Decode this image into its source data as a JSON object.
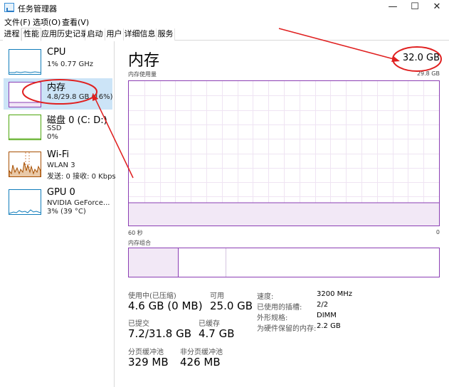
{
  "window": {
    "title": "任务管理器",
    "controls": {
      "minimize": "—",
      "maximize": "☐",
      "close": "✕"
    }
  },
  "menu": [
    "文件(F)",
    "选项(O)",
    "查看(V)"
  ],
  "tabs": [
    "进程",
    "性能",
    "应用历史记录",
    "启动",
    "用户",
    "详细信息",
    "服务"
  ],
  "active_tab": 1,
  "sidebar": {
    "items": [
      {
        "name": "CPU",
        "sub1": "1% 0.77 GHz",
        "sub2": ""
      },
      {
        "name": "内存",
        "sub1": "4.8/29.8 GB (16%)",
        "sub2": ""
      },
      {
        "name": "磁盘 0 (C: D:)",
        "sub1": "SSD",
        "sub2": "0%"
      },
      {
        "name": "Wi-Fi",
        "sub1": "WLAN 3",
        "sub2": "发送: 0 接收: 0 Kbps"
      },
      {
        "name": "GPU 0",
        "sub1": "NVIDIA GeForce...",
        "sub2": "3% (39 °C)"
      }
    ]
  },
  "main": {
    "title": "内存",
    "total": "32.0 GB",
    "usage_label": "内存使用量",
    "usage_max": "29.8 GB",
    "axis_left": "60 秒",
    "axis_right": "0",
    "composition_label": "内存组合",
    "usage_fraction": 0.16,
    "stats": [
      {
        "label": "使用中(已压缩)",
        "value": "4.6 GB (0 MB)"
      },
      {
        "label": "可用",
        "value": "25.0 GB"
      },
      {
        "label": "已提交",
        "value": "7.2/31.8 GB"
      },
      {
        "label": "已缓存",
        "value": "4.7 GB"
      },
      {
        "label": "分页缓冲池",
        "value": "329 MB"
      },
      {
        "label": "非分页缓冲池",
        "value": "426 MB"
      }
    ],
    "details": [
      {
        "label": "速度:",
        "value": "3200 MHz"
      },
      {
        "label": "已使用的插槽:",
        "value": "2/2"
      },
      {
        "label": "外形规格:",
        "value": "DIMM"
      },
      {
        "label": "为硬件保留的内存:",
        "value": "2.2 GB"
      }
    ]
  },
  "colors": {
    "memory": "#8b3eb4",
    "cpu": "#117dbb",
    "disk": "#4da60c",
    "wifi": "#a74f01",
    "gpu": "#117dbb",
    "annotation": "#e02020",
    "selected": "#cce4f7"
  }
}
